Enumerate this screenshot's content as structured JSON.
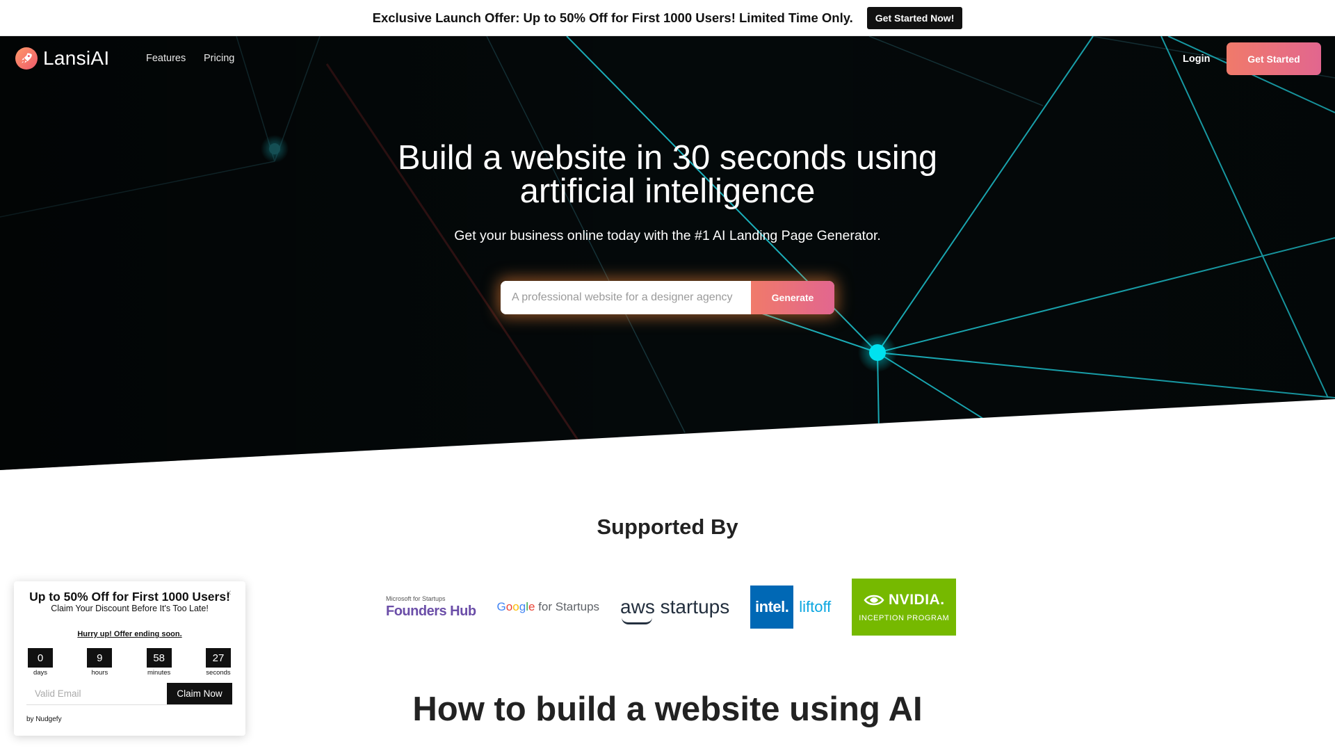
{
  "announcement": {
    "text": "Exclusive Launch Offer: Up to 50% Off for First 1000 Users! Limited Time Only.",
    "button": "Get Started Now!"
  },
  "nav": {
    "brand": "LansiAI",
    "logo_icon": "rocket-icon",
    "links": [
      "Features",
      "Pricing"
    ],
    "login": "Login",
    "cta": "Get Started"
  },
  "hero": {
    "title_line1": "Build a website in 30 seconds using",
    "title_line2": "artificial intelligence",
    "subtitle": "Get your business online today with the #1 AI Landing Page Generator.",
    "input_placeholder": "A professional website for a designer agency",
    "input_value": "",
    "generate": "Generate"
  },
  "supported": {
    "title": "Supported By",
    "logos": {
      "microsoft_small": "Microsoft for Startups",
      "microsoft_big": "Founders Hub",
      "google_brand": "Google",
      "google_suffix": "for Startups",
      "aws": "aws startups",
      "intel_box": "intel.",
      "intel_suffix": "liftoff",
      "nvidia_brand": "NVIDIA.",
      "nvidia_sub": "INCEPTION PROGRAM"
    }
  },
  "how": {
    "title": "How to build a website using AI"
  },
  "popup": {
    "title": "Up to 50% Off for First 1000 Users!",
    "subtitle": "Claim Your Discount Before It's Too Late!",
    "hurry": "Hurry up! Offer ending soon.",
    "countdown": [
      {
        "value": "0",
        "label": "days"
      },
      {
        "value": "9",
        "label": "hours"
      },
      {
        "value": "58",
        "label": "minutes"
      },
      {
        "value": "27",
        "label": "seconds"
      }
    ],
    "email_placeholder": "Valid Email",
    "button": "Claim Now",
    "by": "by Nudgefy",
    "close": "×"
  },
  "colors": {
    "accent_gradient_start": "#f07a6a",
    "accent_gradient_end": "#e2668f",
    "hero_bg": "#04090a",
    "network_line": "#1fc8d4",
    "nvidia_green": "#76b900",
    "intel_blue": "#0068b5"
  }
}
